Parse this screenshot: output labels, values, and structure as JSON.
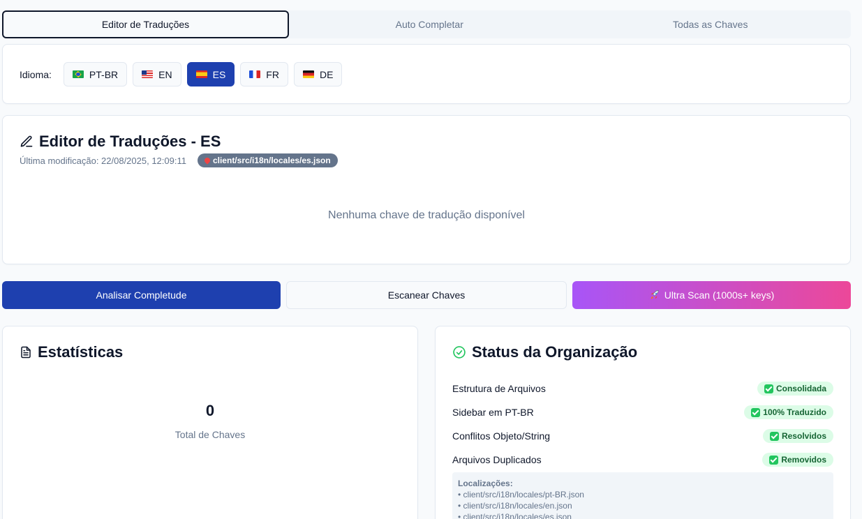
{
  "tabs": [
    {
      "label": "Editor de Traduções",
      "active": true
    },
    {
      "label": "Auto Completar",
      "active": false
    },
    {
      "label": "Todas as Chaves",
      "active": false
    }
  ],
  "language": {
    "label": "Idioma:",
    "options": [
      {
        "code": "PT-BR",
        "flag": "flag-br",
        "active": false
      },
      {
        "code": "EN",
        "flag": "flag-us",
        "active": false
      },
      {
        "code": "ES",
        "flag": "flag-es",
        "active": true
      },
      {
        "code": "FR",
        "flag": "flag-fr",
        "active": false
      },
      {
        "code": "DE",
        "flag": "flag-de",
        "active": false
      }
    ]
  },
  "editor": {
    "title": "Editor de Traduções - ES",
    "icon": "pencil-icon",
    "last_modified": "Última modificação: 22/08/2025, 12:09:11",
    "file_path": "client/src/i18n/locales/es.json",
    "empty_message": "Nenhuma chave de tradução disponível"
  },
  "actions": {
    "analyze_label": "Analisar Completude",
    "scan_label": "Escanear Chaves",
    "ultra_scan_label": "Ultra Scan (1000s+ keys)"
  },
  "stats": {
    "title": "Estatísticas",
    "icon": "document-icon",
    "total_keys_value": "0",
    "total_keys_label": "Total de Chaves"
  },
  "status": {
    "title": "Status da Organização",
    "icon": "check-circle-icon",
    "rows": [
      {
        "label": "Estrutura de Arquivos",
        "badge": "Consolidada"
      },
      {
        "label": "Sidebar em PT-BR",
        "badge": "100% Traduzido"
      },
      {
        "label": "Conflitos Objeto/String",
        "badge": "Resolvidos"
      },
      {
        "label": "Arquivos Duplicados",
        "badge": "Removidos"
      }
    ],
    "locations_title": "Localizações:",
    "locations": [
      "• client/src/i18n/locales/pt-BR.json",
      "• client/src/i18n/locales/en.json",
      "• client/src/i18n/locales/es.json"
    ]
  },
  "colors": {
    "primary": "#1e40af",
    "gradient_start": "#a855f7",
    "gradient_end": "#ec4899",
    "success_bg": "#dcfce7",
    "success_text": "#166534"
  }
}
